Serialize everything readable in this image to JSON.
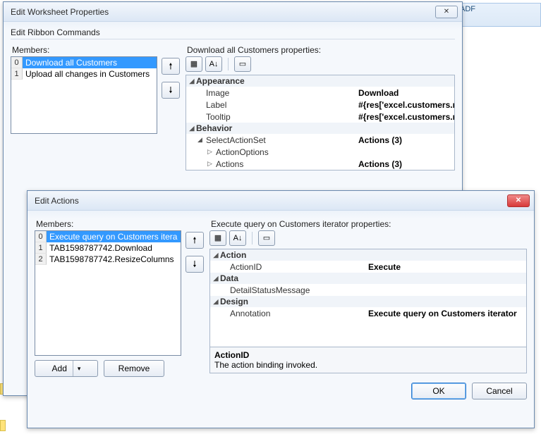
{
  "ribbon_fragment": "ADF",
  "back_dialog": {
    "title": "Edit Worksheet Properties",
    "section_title": "Edit Ribbon Commands",
    "members_label": "Members:",
    "props_label": "Download all Customers properties:",
    "members": [
      "Download all Customers",
      "Upload all changes in Customers"
    ],
    "props": {
      "appearance": {
        "label": "Appearance",
        "image": {
          "name": "Image",
          "value": "Download"
        },
        "labelProp": {
          "name": "Label",
          "value": "#{res['excel.customers.ribbon.dow"
        },
        "tooltip": {
          "name": "Tooltip",
          "value": "#{res['excel.customers.ribbon.dow"
        }
      },
      "behavior": {
        "label": "Behavior",
        "selectActionSet": {
          "name": "SelectActionSet",
          "value": "Actions (3)"
        },
        "actionOptions": {
          "name": "ActionOptions",
          "value": ""
        },
        "actions": {
          "name": "Actions",
          "value": "Actions (3)"
        }
      }
    }
  },
  "front_dialog": {
    "title": "Edit Actions",
    "members_label": "Members:",
    "props_label": "Execute query on Customers iterator properties:",
    "members": [
      "Execute query on Customers itera",
      "TAB1598787742.Download",
      "TAB1598787742.ResizeColumns"
    ],
    "props": {
      "action": {
        "label": "Action",
        "actionId": {
          "name": "ActionID",
          "value": "Execute"
        }
      },
      "data": {
        "label": "Data",
        "detailStatusMessage": {
          "name": "DetailStatusMessage",
          "value": ""
        }
      },
      "design": {
        "label": "Design",
        "annotation": {
          "name": "Annotation",
          "value": "Execute query on Customers iterator"
        }
      }
    },
    "help": {
      "title": "ActionID",
      "desc": "The action binding invoked."
    },
    "add_label": "Add",
    "remove_label": "Remove",
    "ok_label": "OK",
    "cancel_label": "Cancel"
  }
}
